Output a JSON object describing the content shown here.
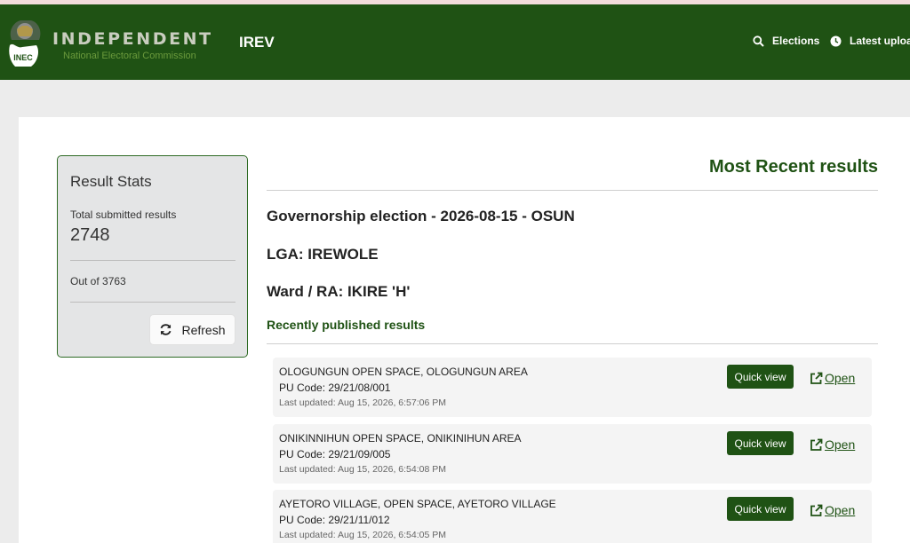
{
  "header": {
    "brand_title": "INDEPENDENT",
    "brand_subtitle": "National Electoral Commission",
    "logo_text": "INEC",
    "app_name": "IREV",
    "nav": [
      {
        "label": "Elections",
        "icon": "search-icon"
      },
      {
        "label": "Latest uploa",
        "icon": "clock-icon"
      }
    ]
  },
  "stats": {
    "title": "Result Stats",
    "total_label": "Total submitted results",
    "total_value": "2748",
    "out_of": "Out of 3763",
    "refresh_label": "Refresh",
    "refresh_icon": "refresh-icon"
  },
  "main": {
    "title": "Most Recent results",
    "election": "Governorship election - 2026-08-15 - OSUN",
    "lga": "LGA: IREWOLE",
    "ward": "Ward / RA: IKIRE 'H'",
    "recently_label": "Recently published results",
    "results": [
      {
        "name": "OLOGUNGUN OPEN SPACE, OLOGUNGUN AREA",
        "pu_code": "PU Code: 29/21/08/001",
        "updated": "Last updated: Aug 15, 2026, 6:57:06 PM",
        "quick_view": "Quick view",
        "open": "Open"
      },
      {
        "name": "ONIKINNIHUN OPEN SPACE, ONIKINIHUN AREA",
        "pu_code": "PU Code: 29/21/09/005",
        "updated": "Last updated: Aug 15, 2026, 6:54:08 PM",
        "quick_view": "Quick view",
        "open": "Open"
      },
      {
        "name": "AYETORO VILLAGE, OPEN SPACE, AYETORO VILLAGE",
        "pu_code": "PU Code: 29/21/11/012",
        "updated": "Last updated: Aug 15, 2026, 6:54:05 PM",
        "quick_view": "Quick view",
        "open": "Open"
      }
    ]
  },
  "colors": {
    "navbar": "#1f5214",
    "accent": "#1f5214",
    "brand_title": "#c9cdbf",
    "brand_subtitle": "#6b9a3c",
    "page_bg": "#ececec"
  }
}
